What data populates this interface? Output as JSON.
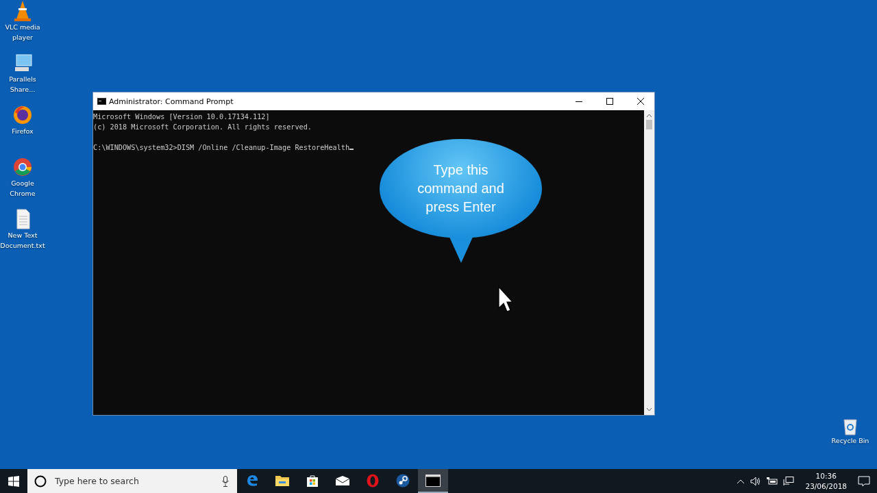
{
  "desktop_icons": [
    {
      "kind": "vlc",
      "label": "VLC media player"
    },
    {
      "kind": "monitor",
      "label": "Parallels Share..."
    },
    {
      "kind": "firefox",
      "label": "Firefox"
    },
    {
      "kind": "chrome",
      "label": "Google Chrome"
    },
    {
      "kind": "document",
      "label": "New Text Document.txt"
    }
  ],
  "recycle_bin": {
    "label": "Recycle Bin"
  },
  "window": {
    "title": "Administrator: Command Prompt",
    "banner": [
      "Microsoft Windows [Version 10.0.17134.112]",
      "(c) 2018 Microsoft Corporation. All rights reserved."
    ],
    "command": "C:\\WINDOWS\\system32>DISM /Online /Cleanup-Image RestoreHealth"
  },
  "callout": {
    "text": "Type this command and press Enter"
  },
  "taskbar": {
    "search": {
      "placeholder": "Type here to search"
    },
    "apps": [
      {
        "kind": "edge",
        "selected": false
      },
      {
        "kind": "folder",
        "selected": false
      },
      {
        "kind": "store",
        "selected": false
      },
      {
        "kind": "mail",
        "selected": false
      },
      {
        "kind": "opera",
        "selected": false
      },
      {
        "kind": "steam",
        "selected": false
      },
      {
        "kind": "console",
        "selected": true
      }
    ],
    "time": "10:36",
    "date": "23/06/2018"
  }
}
